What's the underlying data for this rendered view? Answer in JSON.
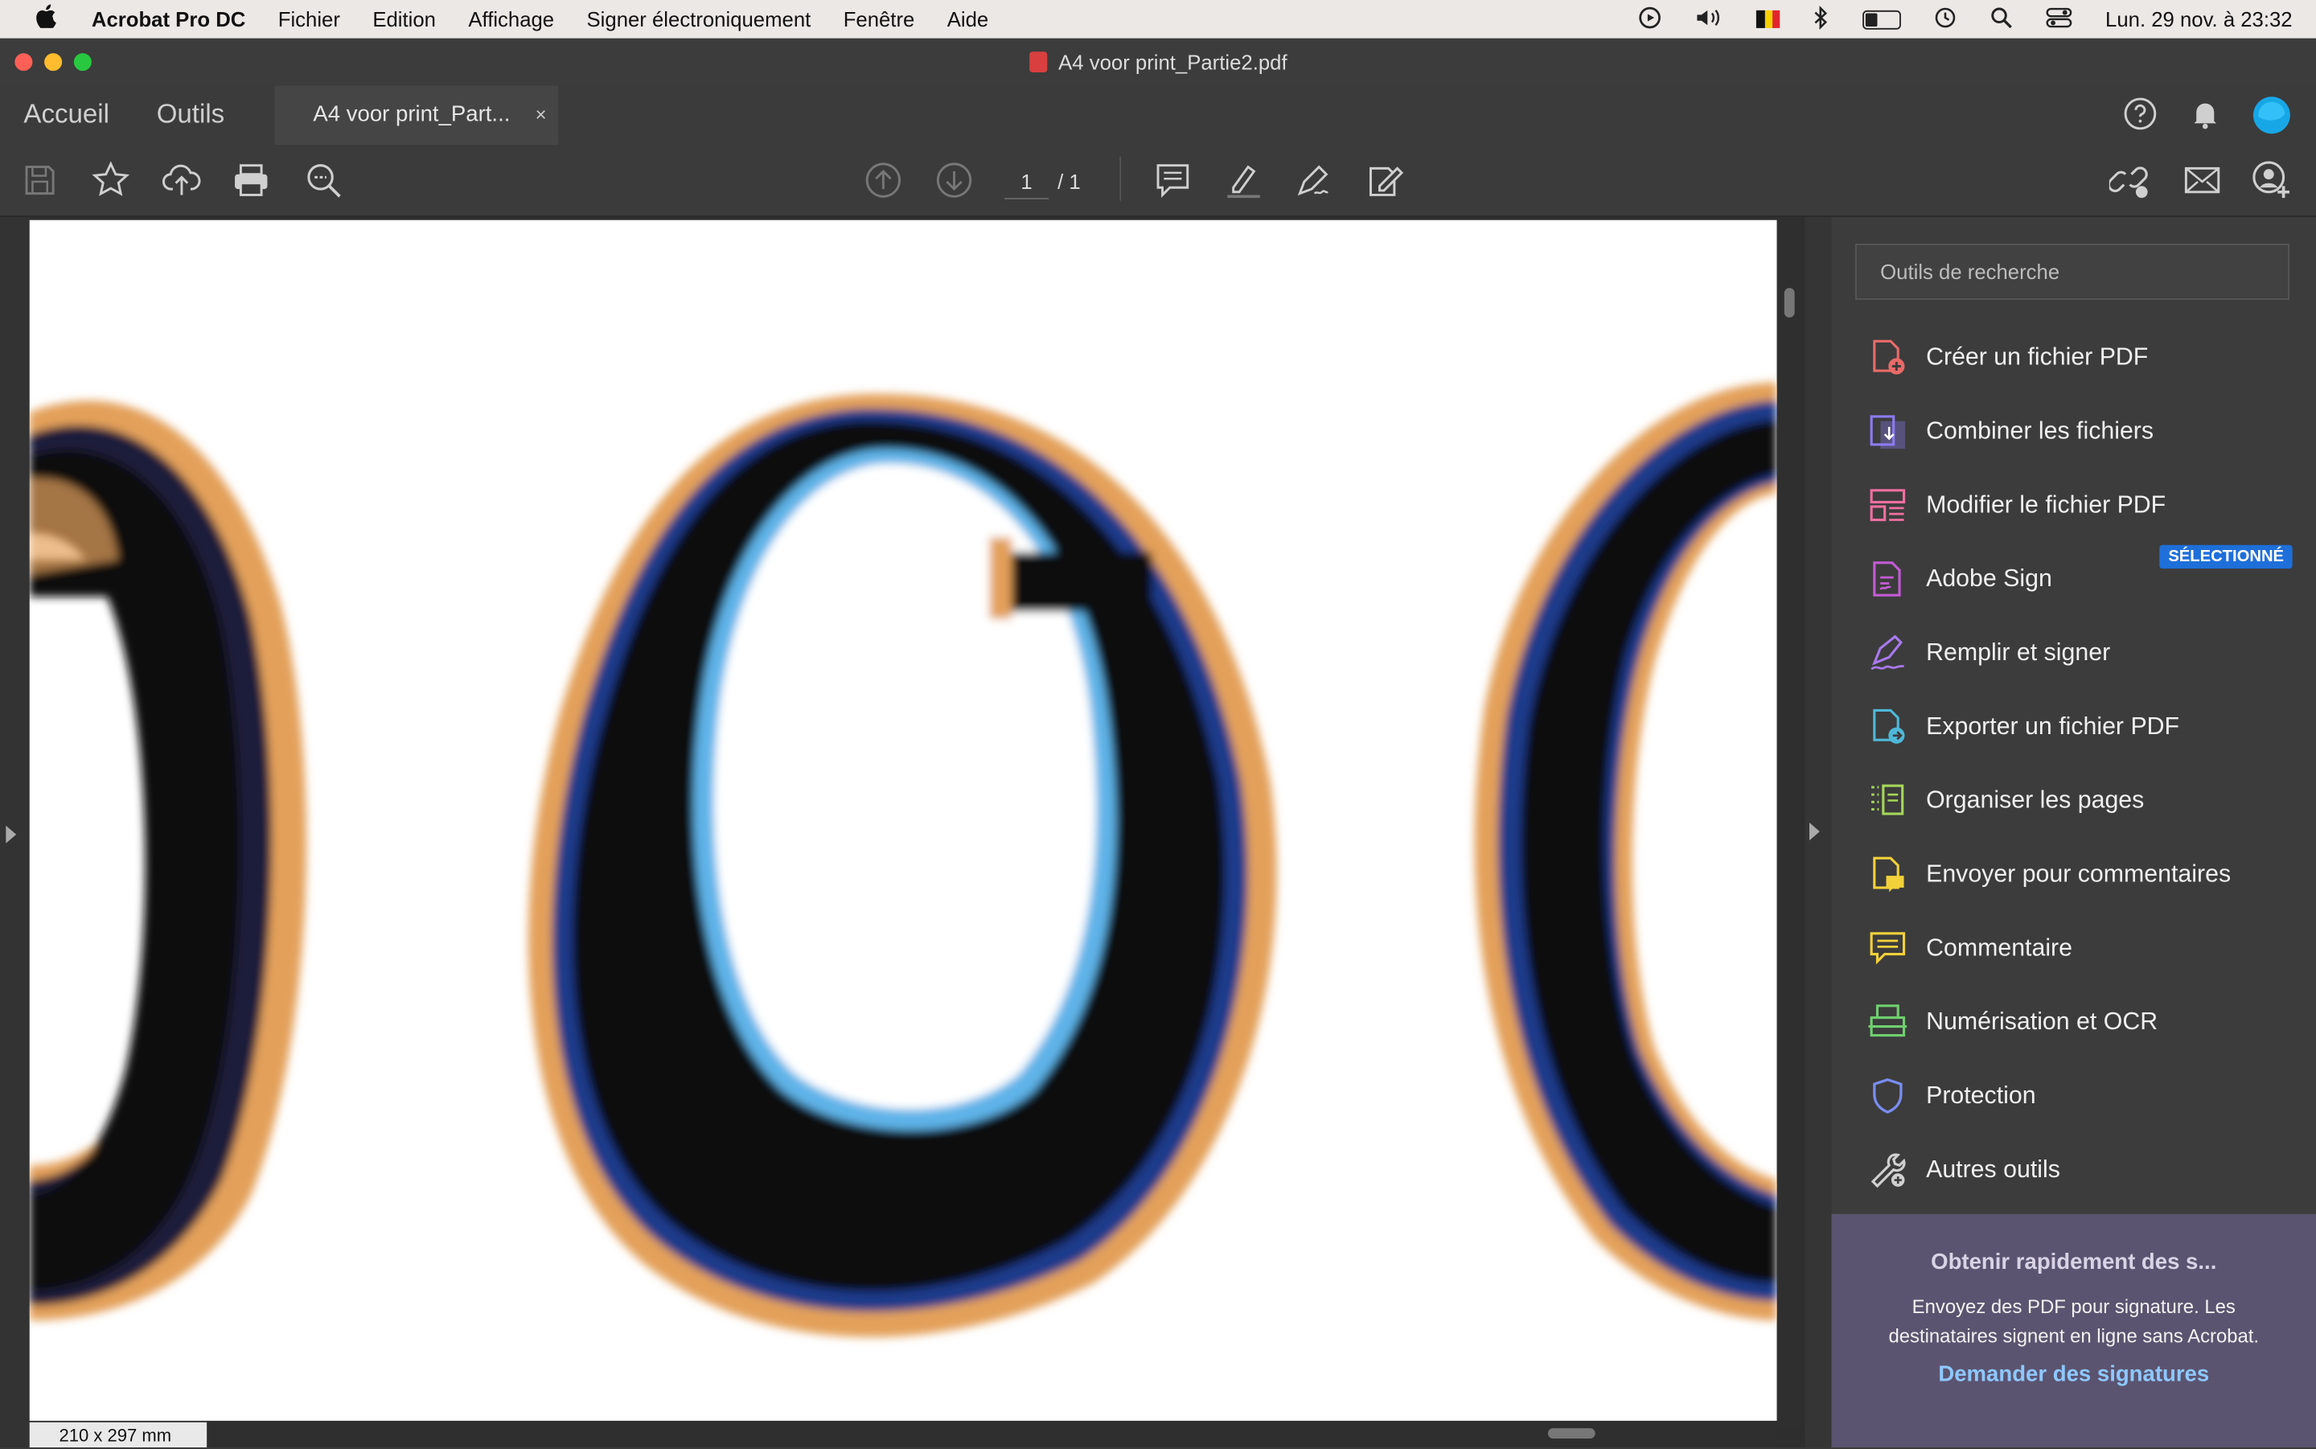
{
  "menubar": {
    "app": "Acrobat Pro DC",
    "items": [
      "Fichier",
      "Edition",
      "Affichage",
      "Signer électroniquement",
      "Fenêtre",
      "Aide"
    ],
    "clock": "Lun. 29 nov. à  23:32"
  },
  "window": {
    "title": "A4 voor print_Partie2.pdf"
  },
  "tabs": {
    "home": "Accueil",
    "tools": "Outils",
    "doc": "A4 voor print_Part...",
    "close": "×"
  },
  "toolbar": {
    "page_current": "1",
    "page_total": "/ 1"
  },
  "statusbar": {
    "page_size": "210 x 297 mm"
  },
  "tools_pane": {
    "search_placeholder": "Outils de recherche",
    "items": [
      {
        "label": "Créer un fichier PDF",
        "icon": "create-pdf-icon",
        "color": "#e86a6a"
      },
      {
        "label": "Combiner les fichiers",
        "icon": "combine-files-icon",
        "color": "#8b7bf2"
      },
      {
        "label": "Modifier le fichier PDF",
        "icon": "edit-pdf-icon",
        "color": "#f06fa0"
      },
      {
        "label": "Adobe Sign",
        "icon": "adobe-sign-icon",
        "color": "#c55bd6"
      },
      {
        "label": "Remplir et signer",
        "icon": "fill-sign-icon",
        "color": "#a979ee"
      },
      {
        "label": "Exporter un fichier PDF",
        "icon": "export-pdf-icon",
        "color": "#4fb8d8"
      },
      {
        "label": "Organiser les pages",
        "icon": "organize-pages-icon",
        "color": "#a6d65a"
      },
      {
        "label": "Envoyer pour commentaires",
        "icon": "send-comments-icon",
        "color": "#f2d13a"
      },
      {
        "label": "Commentaire",
        "icon": "comment-icon",
        "color": "#f2d13a"
      },
      {
        "label": "Numérisation et OCR",
        "icon": "scan-ocr-icon",
        "color": "#6fcf6f"
      },
      {
        "label": "Protection",
        "icon": "shield-icon",
        "color": "#7a8cf0"
      },
      {
        "label": "Autres outils",
        "icon": "wrench-icon",
        "color": "#d0d0d0"
      }
    ],
    "badge": "SÉLECTIONNÉ",
    "promo": {
      "title": "Obtenir rapidement des s...",
      "body": "Envoyez des PDF pour signature. Les destinataires signent en ligne sans Acrobat.",
      "link": "Demander des signatures"
    }
  }
}
